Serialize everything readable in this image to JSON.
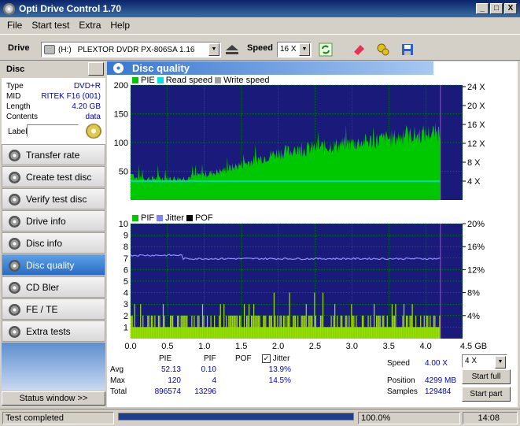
{
  "window": {
    "title": "Opti Drive Control 1.70",
    "controls": [
      "_",
      "□",
      "X"
    ]
  },
  "menu": [
    "File",
    "Start test",
    "Extra",
    "Help"
  ],
  "toolbar": {
    "drive_label": "Drive",
    "drive_letter": "(H:)",
    "drive_name": "PLEXTOR DVDR   PX-806SA 1.16",
    "speed_label": "Speed",
    "speed_value": "16 X"
  },
  "disc": {
    "header": "Disc",
    "rows": [
      {
        "k": "Type",
        "v": "DVD+R"
      },
      {
        "k": "MID",
        "v": "RITEK F16 (001)"
      },
      {
        "k": "Length",
        "v": "4.20 GB"
      },
      {
        "k": "Contents",
        "v": "data"
      }
    ],
    "label_key": "Label"
  },
  "nav": [
    "Transfer rate",
    "Create test disc",
    "Verify test disc",
    "Drive info",
    "Disc info",
    "Disc quality",
    "CD Bler",
    "FE / TE",
    "Extra tests"
  ],
  "nav_active": "Disc quality",
  "status_window_btn": "Status window >>",
  "panel": {
    "title": "Disc quality"
  },
  "colors": {
    "plot_bg": "#1a1a7a",
    "pie": "#00c800",
    "read_speed": "#00e0e0",
    "write_speed": "#a0a0a0",
    "pif": "#00c800",
    "jitter": "#8080ff",
    "pof": "#000000",
    "panel_head": "#3a78d0"
  },
  "chart_data": [
    {
      "type": "area",
      "series": [
        {
          "name": "PIE",
          "values": "noisy, ~35 at start rising to ~110 near 4.2 GB"
        },
        {
          "name": "Read speed",
          "values": "flat ~4 X"
        },
        {
          "name": "Write speed"
        }
      ],
      "xlim": [
        0,
        4.5
      ],
      "x_ticks": [
        "0.0",
        "0.5",
        "1.0",
        "1.5",
        "2.0",
        "2.5",
        "3.0",
        "3.5",
        "4.0",
        "4.5 GB"
      ],
      "y_left_ticks": [
        "200",
        "150",
        "100",
        "50"
      ],
      "y_right_ticks": [
        "24 X",
        "20 X",
        "16 X",
        "12 X",
        "8 X",
        "4 X"
      ],
      "ylim": [
        0,
        200
      ],
      "x_end": 4.2
    },
    {
      "type": "bar",
      "series": [
        {
          "name": "PIF",
          "values": "mostly 0–2, spikes to 4"
        },
        {
          "name": "Jitter",
          "values": "~13.9% flat, small dip near 0.7 GB"
        },
        {
          "name": "POF"
        }
      ],
      "xlim": [
        0,
        4.5
      ],
      "x_ticks": [
        "0.0",
        "0.5",
        "1.0",
        "1.5",
        "2.0",
        "2.5",
        "3.0",
        "3.5",
        "4.0",
        "4.5 GB"
      ],
      "y_left_ticks": [
        "10",
        "9",
        "8",
        "7",
        "6",
        "5",
        "4",
        "3",
        "2",
        "1"
      ],
      "y_right_ticks": [
        "20%",
        "16%",
        "12%",
        "8%",
        "4%"
      ],
      "ylim": [
        0,
        10
      ]
    }
  ],
  "stats": {
    "headers": [
      "PIE",
      "PIF",
      "POF",
      "Jitter"
    ],
    "jitter_checked": "✓",
    "rows": [
      {
        "label": "Avg",
        "pie": "52.13",
        "pif": "0.10",
        "pof": "",
        "jit": "13.9%"
      },
      {
        "label": "Max",
        "pie": "120",
        "pif": "4",
        "pof": "",
        "jit": "14.5%"
      },
      {
        "label": "Total",
        "pie": "896574",
        "pif": "13296",
        "pof": "",
        "jit": ""
      }
    ],
    "speed_label": "Speed",
    "speed_value": "4.00 X",
    "position_label": "Position",
    "position_value": "4299 MB",
    "samples_label": "Samples",
    "samples_value": "129484",
    "speed_select": "4 X",
    "start_full": "Start full",
    "start_part": "Start part"
  },
  "statusbar": {
    "text": "Test completed",
    "progress_text": "100.0%",
    "progress": 1.0,
    "time": "14:08"
  }
}
